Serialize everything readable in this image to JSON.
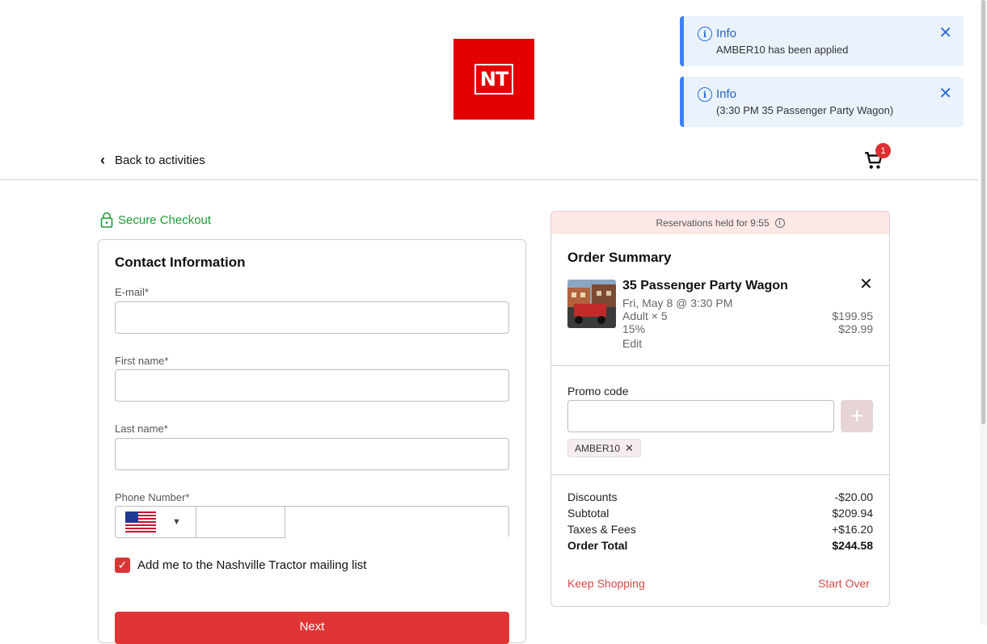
{
  "brand": {
    "logo_text": "NT",
    "color": "#e30000"
  },
  "toasts": [
    {
      "title": "Info",
      "message": "AMBER10 has been applied"
    },
    {
      "title": "Info",
      "message": "(3:30 PM 35 Passenger Party Wagon)"
    }
  ],
  "header": {
    "back_label": "Back to activities",
    "cart_count": "1"
  },
  "secure_label": "Secure Checkout",
  "contact": {
    "title": "Contact Information",
    "email_label": "E-mail*",
    "first_name_label": "First name*",
    "last_name_label": "Last name*",
    "phone_label": "Phone Number*",
    "mailing_label": "Add me to the Nashville Tractor mailing list",
    "mailing_checked": true,
    "next_label": "Next"
  },
  "order": {
    "reservation_text": "Reservations held for 9:55",
    "title": "Order Summary",
    "item": {
      "name": "35 Passenger Party Wagon",
      "datetime": "Fri, May 8 @ 3:30 PM",
      "line1_label": "Adult × 5",
      "line1_value": "$199.95",
      "line2_label": "15%",
      "line2_value": "$29.99",
      "edit_label": "Edit"
    },
    "promo_label": "Promo code",
    "promo_chip": "AMBER10",
    "totals": [
      {
        "label": "Discounts",
        "value": "-$20.00"
      },
      {
        "label": "Subtotal",
        "value": "$209.94"
      },
      {
        "label": "Taxes & Fees",
        "value": "+$16.20"
      },
      {
        "label": "Order Total",
        "value": "$244.58"
      }
    ],
    "keep_shopping": "Keep Shopping",
    "start_over": "Start Over"
  }
}
